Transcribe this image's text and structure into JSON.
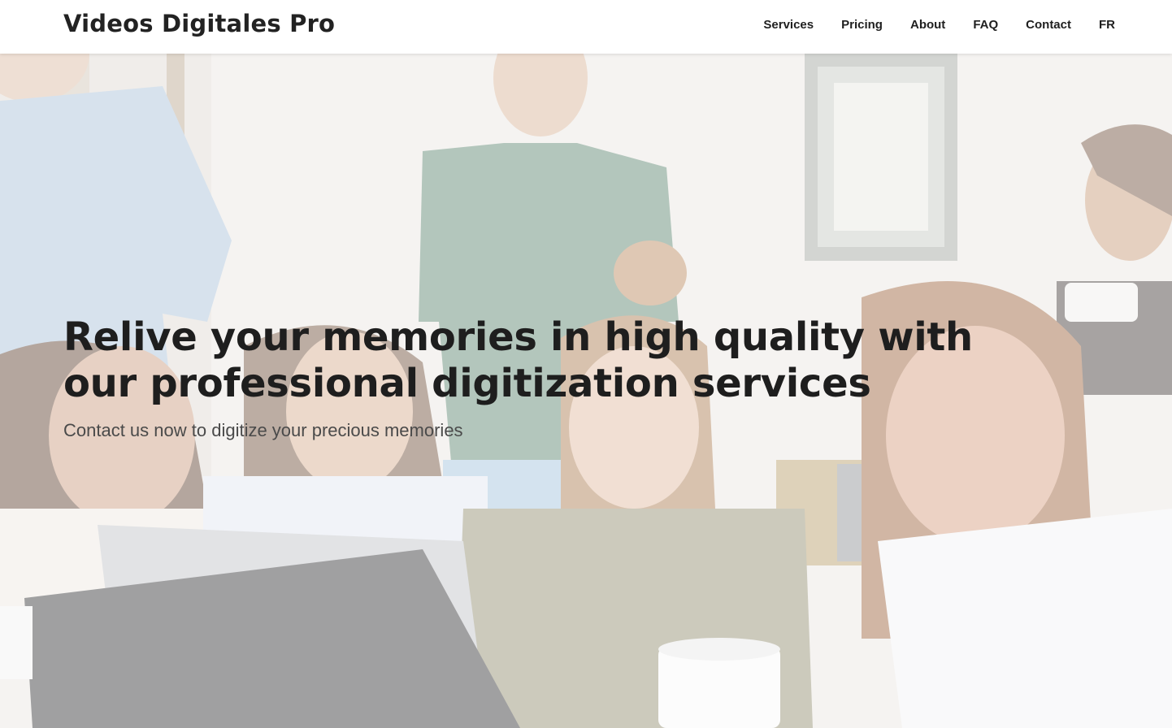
{
  "header": {
    "brand": "Videos Digitales Pro",
    "nav": [
      {
        "label": "Services"
      },
      {
        "label": "Pricing"
      },
      {
        "label": "About"
      },
      {
        "label": "FAQ"
      },
      {
        "label": "Contact"
      },
      {
        "label": "FR"
      }
    ]
  },
  "hero": {
    "headline": "Relive your memories in high quality with our professional digitization services",
    "subheadline": "Contact us now to digitize your precious memories",
    "background_image": "group-of-people-looking-at-laptop-photo"
  },
  "colors": {
    "header_bg": "#ffffff",
    "text_primary": "#1e1e1e",
    "text_secondary": "#4a4a4a"
  }
}
